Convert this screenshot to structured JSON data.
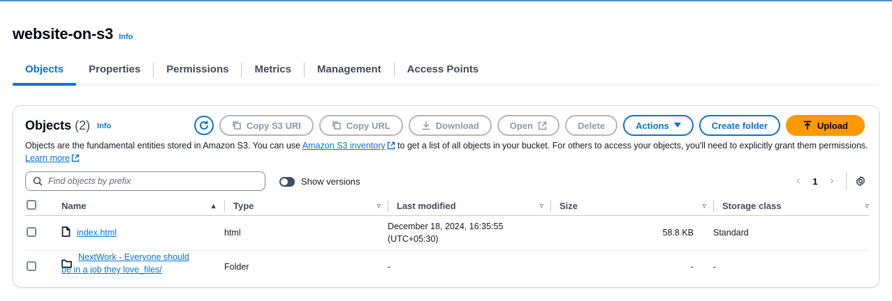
{
  "bucket": {
    "name": "website-on-s3",
    "info": "Info"
  },
  "tabs": [
    {
      "label": "Objects",
      "active": true
    },
    {
      "label": "Properties"
    },
    {
      "label": "Permissions"
    },
    {
      "label": "Metrics"
    },
    {
      "label": "Management"
    },
    {
      "label": "Access Points"
    }
  ],
  "objects_panel": {
    "title": "Objects",
    "count": "(2)",
    "info": "Info",
    "buttons": {
      "copy_s3_uri": "Copy S3 URI",
      "copy_url": "Copy URL",
      "download": "Download",
      "open": "Open",
      "delete": "Delete",
      "actions": "Actions",
      "create_folder": "Create folder",
      "upload": "Upload"
    },
    "description": {
      "part1": "Objects are the fundamental entities stored in Amazon S3. You can use ",
      "link1": "Amazon S3 inventory",
      "part2": " to get a list of all objects in your bucket. For others to access your objects, you'll need to explicitly grant them permissions. ",
      "link2": "Learn more"
    },
    "search": {
      "placeholder": "Find objects by prefix"
    },
    "show_versions": "Show versions",
    "pagination": {
      "current_page": "1"
    },
    "columns": [
      "Name",
      "Type",
      "Last modified",
      "Size",
      "Storage class"
    ],
    "rows": [
      {
        "name": "index.html",
        "type": "html",
        "last_modified_line1": "December 18, 2024, 16:35:55",
        "last_modified_line2": "(UTC+05:30)",
        "size": "58.8 KB",
        "storage_class": "Standard",
        "icon": "file-icon"
      },
      {
        "name_line1": "NextWork - Everyone should",
        "name_line2": "be in a job they love_files/",
        "type": "Folder",
        "last_modified": "-",
        "size": "-",
        "storage_class": "-",
        "icon": "folder-icon"
      }
    ]
  },
  "colors": {
    "accent": "#0972d3",
    "upload": "#ff9900",
    "text": "#16191f"
  }
}
